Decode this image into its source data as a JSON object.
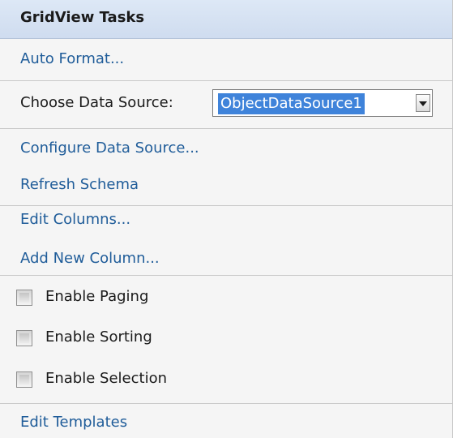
{
  "panel": {
    "title": "GridView Tasks"
  },
  "links": {
    "auto_format": "Auto Format...",
    "configure_data_source": "Configure Data Source...",
    "refresh_schema": "Refresh Schema",
    "edit_columns": "Edit Columns...",
    "add_new_column": "Add New Column...",
    "edit_templates": "Edit Templates"
  },
  "data_source": {
    "label": "Choose Data Source:",
    "selected": "ObjectDataSource1"
  },
  "options": {
    "paging": {
      "label": "Enable Paging",
      "checked": false
    },
    "sorting": {
      "label": "Enable Sorting",
      "checked": false
    },
    "selection": {
      "label": "Enable Selection",
      "checked": false
    }
  }
}
